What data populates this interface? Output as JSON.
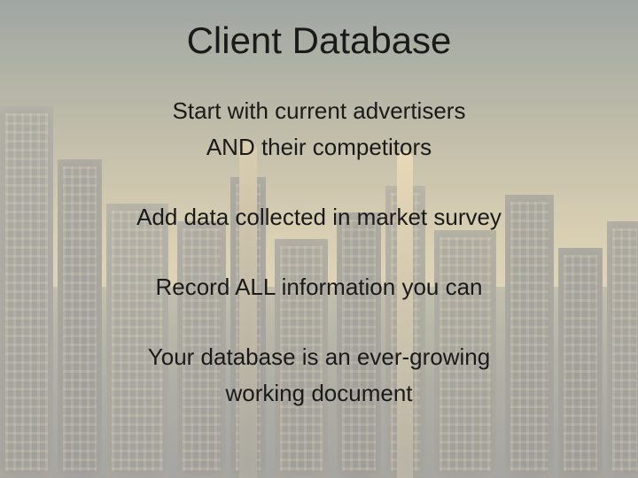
{
  "title": "Client Database",
  "lines": {
    "l1": "Start with current advertisers",
    "l2": "AND their competitors",
    "l3": "Add data collected in market survey",
    "l4": "Record ALL information you can",
    "l5": "Your database is an ever-growing",
    "l6": "working document"
  }
}
